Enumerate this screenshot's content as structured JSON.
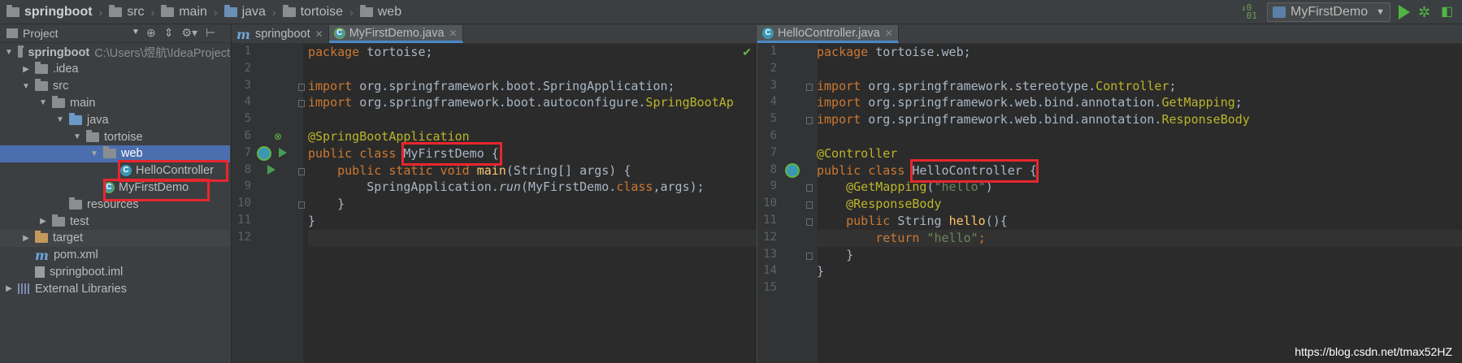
{
  "breadcrumbs": [
    {
      "label": "springboot",
      "kind": "project"
    },
    {
      "label": "src",
      "kind": "folder"
    },
    {
      "label": "main",
      "kind": "folder"
    },
    {
      "label": "java",
      "kind": "folder-blue"
    },
    {
      "label": "tortoise",
      "kind": "folder"
    },
    {
      "label": "web",
      "kind": "folder"
    }
  ],
  "run_config": {
    "label": "MyFirstDemo"
  },
  "project_panel": {
    "title": "Project",
    "tree": [
      {
        "label": "springboot",
        "hint": "C:\\Users\\煜航\\IdeaProject",
        "depth": 0,
        "arrow": "▼",
        "icon": "folder",
        "bold": true
      },
      {
        "label": ".idea",
        "depth": 1,
        "arrow": "▶",
        "icon": "folder"
      },
      {
        "label": "src",
        "depth": 1,
        "arrow": "▼",
        "icon": "folder"
      },
      {
        "label": "main",
        "depth": 2,
        "arrow": "▼",
        "icon": "folder"
      },
      {
        "label": "java",
        "depth": 3,
        "arrow": "▼",
        "icon": "folder-src"
      },
      {
        "label": "tortoise",
        "depth": 4,
        "arrow": "▼",
        "icon": "folder"
      },
      {
        "label": "web",
        "depth": 5,
        "arrow": "▼",
        "icon": "folder",
        "selected": true
      },
      {
        "label": "HelloController",
        "depth": 6,
        "arrow": "",
        "icon": "class"
      },
      {
        "label": "MyFirstDemo",
        "depth": 5,
        "arrow": "",
        "icon": "spring-class"
      },
      {
        "label": "resources",
        "depth": 3,
        "arrow": "",
        "icon": "folder"
      },
      {
        "label": "test",
        "depth": 2,
        "arrow": "▶",
        "icon": "folder"
      },
      {
        "label": "target",
        "depth": 1,
        "arrow": "▶",
        "icon": "folder-orange",
        "dim": true
      },
      {
        "label": "pom.xml",
        "depth": 1,
        "arrow": "",
        "icon": "maven"
      },
      {
        "label": "springboot.iml",
        "depth": 1,
        "arrow": "",
        "icon": "iml"
      },
      {
        "label": "External Libraries",
        "depth": 0,
        "arrow": "▶",
        "icon": "libs"
      }
    ]
  },
  "left_editor": {
    "tabs": [
      {
        "label": "springboot",
        "icon": "maven",
        "active": false
      },
      {
        "label": "MyFirstDemo.java",
        "icon": "spring-class",
        "active": true
      }
    ],
    "current_line": 12,
    "lines": [
      [
        [
          "kw",
          "package"
        ],
        [
          "p",
          " tortoise;"
        ]
      ],
      [],
      [
        [
          "kw",
          "import"
        ],
        [
          "p",
          " org.springframework.boot.SpringApplication;"
        ]
      ],
      [
        [
          "kw",
          "import"
        ],
        [
          "p",
          " org.springframework.boot.autoconfigure."
        ],
        [
          "an",
          "SpringBootAp"
        ]
      ],
      [],
      [
        [
          "an",
          "@SpringBootApplication"
        ]
      ],
      [
        [
          "kw",
          "public class "
        ],
        [
          "p",
          "MyFirstDemo"
        ],
        [
          "p",
          " {"
        ]
      ],
      [
        [
          "p",
          "    "
        ],
        [
          "kw",
          "public static void "
        ],
        [
          "fn",
          "main"
        ],
        [
          "p",
          "(String[] args) {"
        ]
      ],
      [
        [
          "p",
          "        SpringApplication."
        ],
        [
          "it",
          "run"
        ],
        [
          "p",
          "(MyFirstDemo."
        ],
        [
          "kw",
          "class"
        ],
        [
          "p",
          ",args);"
        ]
      ],
      [
        [
          "p",
          "    }"
        ]
      ],
      [
        [
          "p",
          "}"
        ]
      ],
      []
    ]
  },
  "right_editor": {
    "tabs": [
      {
        "label": "HelloController.java",
        "icon": "class",
        "active": true
      }
    ],
    "current_line": 12,
    "lines": [
      [
        [
          "kw",
          "package"
        ],
        [
          "p",
          " tortoise.web;"
        ]
      ],
      [],
      [
        [
          "kw",
          "import"
        ],
        [
          "p",
          " org.springframework.stereotype."
        ],
        [
          "an",
          "Controller"
        ],
        [
          "p",
          ";"
        ]
      ],
      [
        [
          "kw",
          "import"
        ],
        [
          "p",
          " org.springframework.web.bind.annotation."
        ],
        [
          "an",
          "GetMapping"
        ],
        [
          "p",
          ";"
        ]
      ],
      [
        [
          "kw",
          "import"
        ],
        [
          "p",
          " org.springframework.web.bind.annotation."
        ],
        [
          "an",
          "ResponseBody"
        ]
      ],
      [],
      [
        [
          "an",
          "@Controller"
        ]
      ],
      [
        [
          "kw",
          "public class "
        ],
        [
          "p",
          "HelloController"
        ],
        [
          "p",
          " {"
        ]
      ],
      [
        [
          "p",
          "    "
        ],
        [
          "an",
          "@GetMapping"
        ],
        [
          "p",
          "("
        ],
        [
          "st",
          "\"hello\""
        ],
        [
          "p",
          ")"
        ]
      ],
      [
        [
          "p",
          "    "
        ],
        [
          "an",
          "@ResponseBody"
        ]
      ],
      [
        [
          "p",
          "    "
        ],
        [
          "kw",
          "public "
        ],
        [
          "p",
          "String "
        ],
        [
          "fn",
          "hello"
        ],
        [
          "p",
          "(){"
        ]
      ],
      [
        [
          "p",
          "        "
        ],
        [
          "kw",
          "return "
        ],
        [
          "st",
          "\"hello\""
        ],
        [
          "kw",
          ";"
        ]
      ],
      [
        [
          "p",
          "    }"
        ]
      ],
      [
        [
          "p",
          "}"
        ]
      ],
      []
    ]
  },
  "watermark": "https://blog.csdn.net/tmax52HZ",
  "colors": {
    "highlight_box": "#e8262e",
    "selection": "#4b6eaf",
    "keyword": "#cc7832",
    "annotation": "#bbb529",
    "string": "#6a8759"
  }
}
